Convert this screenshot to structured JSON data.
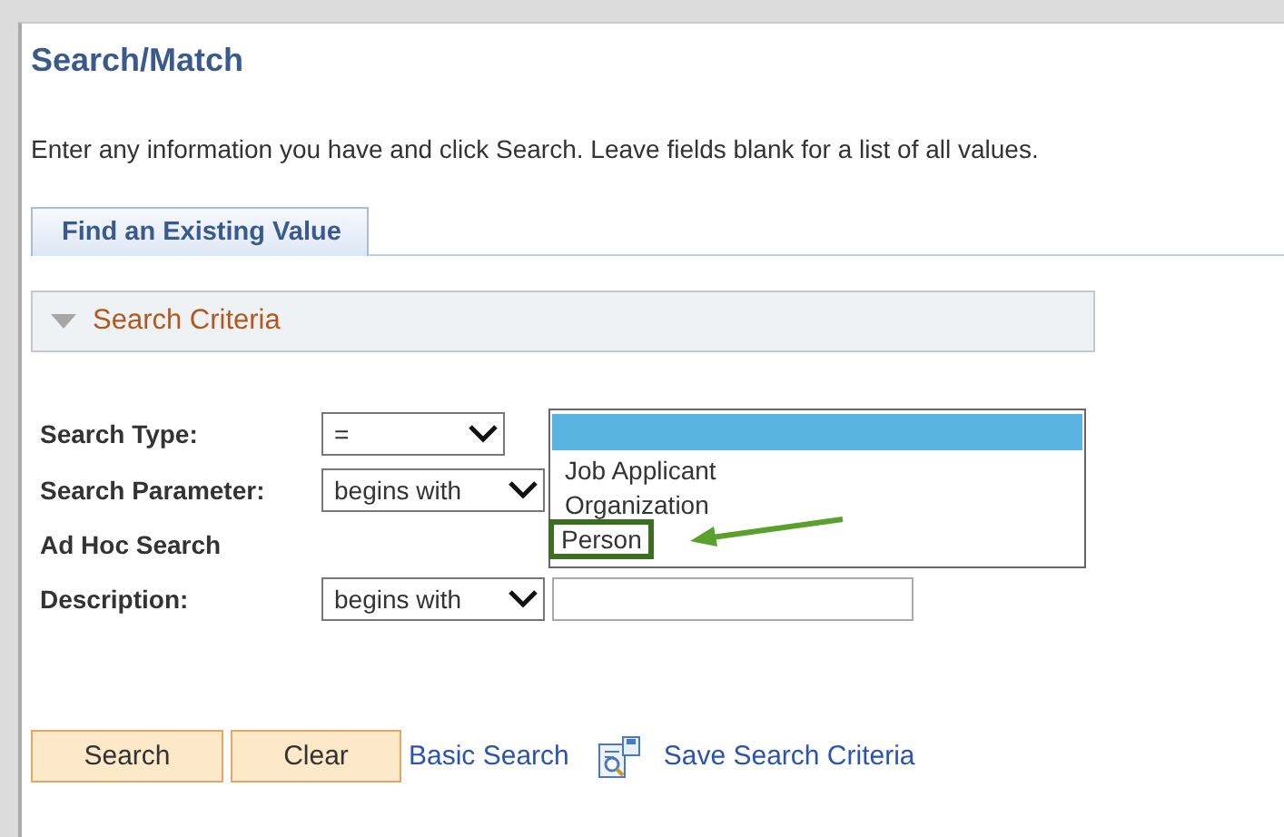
{
  "page_title": "Search/Match",
  "instructions": "Enter any information you have and click Search. Leave fields blank for a list of all values.",
  "tabs": [
    {
      "label": "Find an Existing Value",
      "selected": true
    }
  ],
  "section": {
    "label": "Search Criteria",
    "expanded": true
  },
  "fields": [
    {
      "kind": "select",
      "label": "Search Type:",
      "value": "="
    },
    {
      "kind": "select",
      "label": "Search Parameter:",
      "value": "begins with"
    },
    {
      "kind": "heading",
      "label": "Ad Hoc Search"
    },
    {
      "kind": "select-input",
      "label": "Description:",
      "value": "begins with"
    }
  ],
  "dropdown": {
    "blank_highlighted": true,
    "options": [
      {
        "label": "Job Applicant",
        "selected": false,
        "callout": false
      },
      {
        "label": "Organization",
        "selected": false,
        "callout": false
      },
      {
        "label": "Person",
        "selected": false,
        "callout": true
      }
    ]
  },
  "buttons": [
    "Search",
    "Clear"
  ],
  "links": [
    {
      "kind": "plain",
      "label": "Basic Search"
    },
    {
      "kind": "save",
      "label": "Save Search Criteria"
    }
  ]
}
